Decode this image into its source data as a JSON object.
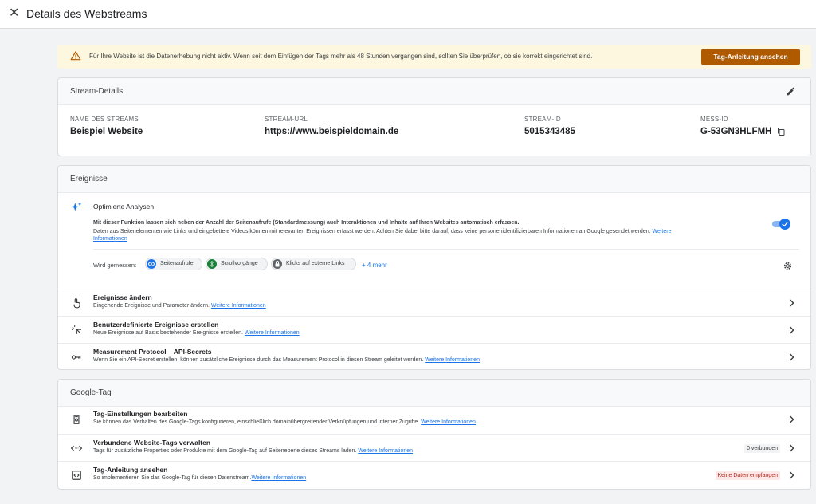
{
  "header": {
    "close_glyph": "✕",
    "title": "Details des Webstreams"
  },
  "banner": {
    "message": "Für Ihre Website ist die Datenerhebung nicht aktiv. Wenn seit dem Einfügen der Tags mehr als 48 Stunden vergangen sind, sollten Sie überprüfen, ob sie korrekt eingerichtet sind.",
    "button_label": "Tag-Anleitung ansehen",
    "icon": "warning-icon",
    "color": "#b05a00"
  },
  "stream_details": {
    "heading": "Stream-Details",
    "fields": [
      {
        "label": "NAME DES STREAMS",
        "value": "Beispiel Website"
      },
      {
        "label": "STREAM-URL",
        "value": "https://www.beispieldomain.de"
      },
      {
        "label": "STREAM-ID",
        "value": "5015343485"
      },
      {
        "label": "MESS-ID",
        "value": "G-53GN3HLFMH"
      }
    ]
  },
  "events": {
    "heading": "Ereignisse",
    "enhanced": {
      "title": "Optimierte Analysen",
      "desc1": "Mit dieser Funktion lassen sich neben der Anzahl der Seitenaufrufe (Standardmessung) auch Interaktionen und Inhalte auf Ihren Websites automatisch erfassen.",
      "desc2": "Daten aus Seitenelementen wie Links und eingebettete Videos können mit relevanten Ereignissen erfasst werden. Achten Sie dabei bitte darauf, dass keine personenidentifizierbaren Informationen an Google gesendet werden.",
      "link1": "Weitere",
      "link2": "Informationen",
      "toggle_on": true,
      "measured_label": "Wird gemessen:",
      "chips": [
        "Seitenaufrufe",
        "Scrollvorgänge",
        "Klicks auf externe Links"
      ],
      "more": "+ 4 mehr"
    },
    "rows": [
      {
        "title": "Ereignisse ändern",
        "sub": "Eingehende Ereignisse und Parameter ändern.",
        "link": "Weitere Informationen"
      },
      {
        "title": "Benutzerdefinierte Ereignisse erstellen",
        "sub": "Neue Ereignisse auf Basis bestehender Ereignisse erstellen.",
        "link": "Weitere Informationen"
      },
      {
        "title": "Measurement Protocol – API-Secrets",
        "sub": "Wenn Sie ein API-Secret erstellen, können zusätzliche Ereignisse durch das Measurement Protocol in diesen Stream geleitet werden.",
        "link": "Weitere Informationen"
      }
    ]
  },
  "google_tag": {
    "heading": "Google-Tag",
    "rows": [
      {
        "title": "Tag-Einstellungen bearbeiten",
        "sub": "Sie können das Verhalten des Google-Tags konfigurieren, einschließlich domainübergreifender Verknüpfungen und interner Zugriffe.",
        "link": "Weitere Informationen",
        "badge": ""
      },
      {
        "title": "Verbundene Website-Tags verwalten",
        "sub": "Tags für zusätzliche Properties oder Produkte mit dem Google-Tag auf Seitenebene dieses Streams laden.",
        "link": "Weitere Informationen",
        "badge": "0 verbunden"
      },
      {
        "title": "Tag-Anleitung ansehen",
        "sub": "So implementieren Sie das Google-Tag für diesen Datenstream.",
        "link": "Weitere Informationen",
        "badge": "Keine Daten empfangen"
      }
    ]
  }
}
